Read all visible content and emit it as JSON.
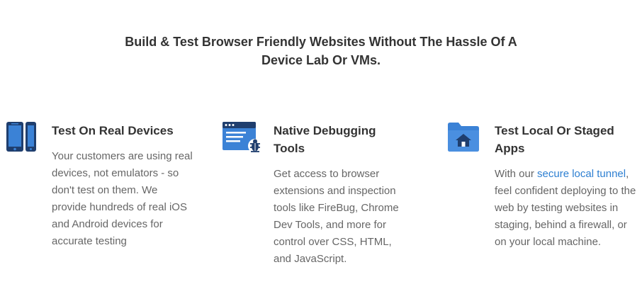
{
  "headline": {
    "line1": "Build & Test Browser Friendly Websites Without The Hassle Of A",
    "line2": "Device Lab Or VMs."
  },
  "features": [
    {
      "icon": "devices-icon",
      "title": "Test On Real Devices",
      "description": "Your customers are using real devices, not emulators - so don't test on them. We provide hundreds of real iOS and Android devices for accurate testing"
    },
    {
      "icon": "debug-browser-icon",
      "title": "Native Debugging Tools",
      "description": "Get access to browser extensions and inspection tools like FireBug, Chrome Dev Tools, and more for control over CSS, HTML, and JavaScript."
    },
    {
      "icon": "local-folder-icon",
      "title": "Test Local Or Staged Apps",
      "description_prefix": "With our ",
      "description_link": "secure local tunnel",
      "description_suffix": ", feel confident deploying to the web by testing websites in staging, behind a firewall, or on your local machine."
    }
  ],
  "colors": {
    "accent": "#2d7fd1",
    "icon_dark": "#1f3e6e",
    "icon_blue": "#3b82d6",
    "heading": "#333333",
    "body_text": "#666666"
  }
}
